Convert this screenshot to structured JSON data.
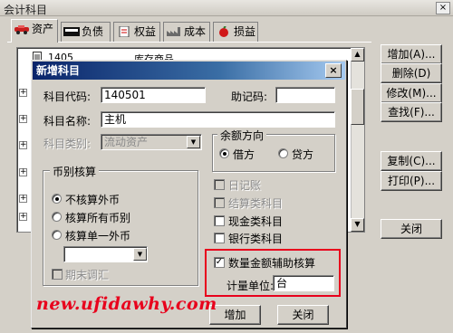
{
  "window": {
    "title": "会计科目",
    "close_glyph": "×"
  },
  "tabs": [
    {
      "label": "资产",
      "active": true
    },
    {
      "label": "负债",
      "active": false
    },
    {
      "label": "权益",
      "active": false
    },
    {
      "label": "成本",
      "active": false
    },
    {
      "label": "损益",
      "active": false
    }
  ],
  "list": {
    "first_row": {
      "code": "1405",
      "name": "库存商品"
    }
  },
  "buttons": {
    "add": "增加(A)...",
    "delete": "删除(D)",
    "modify": "修改(M)...",
    "find": "查找(F)...",
    "copy": "复制(C)...",
    "print": "打印(P)...",
    "close": "关闭"
  },
  "dialog": {
    "title": "新增科目",
    "close_glyph": "×",
    "subject_code_label": "科目代码:",
    "subject_code_value": "140501",
    "mnemonic_label": "助记码:",
    "mnemonic_value": "",
    "subject_name_label": "科目名称:",
    "subject_name_value": "主机",
    "subject_type_label": "科目类别:",
    "subject_type_value": "流动资产",
    "balance_direction": {
      "title": "余额方向",
      "options": [
        "借方",
        "贷方"
      ],
      "selected": "借方"
    },
    "currency": {
      "title": "币别核算",
      "options": [
        "不核算外币",
        "核算所有币别",
        "核算单一外币"
      ],
      "selected": "不核算外币",
      "single_currency_value": "",
      "period_end_adjust": "期末调汇"
    },
    "checkboxes": [
      {
        "label": "日记账",
        "checked": false,
        "enabled": false
      },
      {
        "label": "结算类科目",
        "checked": false,
        "enabled": false
      },
      {
        "label": "现金类科目",
        "checked": false,
        "enabled": true
      },
      {
        "label": "银行类科目",
        "checked": false,
        "enabled": true
      }
    ],
    "quantity_aux": {
      "label": "数量金额辅助核算",
      "checked": true
    },
    "unit_label": "计量单位:",
    "unit_value": "台",
    "add_button": "增加",
    "close_button": "关闭"
  },
  "watermark": "new.ufidawhy.com",
  "colors": {
    "titlebar": "#0a246a",
    "highlight": "#e8001c",
    "face": "#d4d0c8"
  }
}
